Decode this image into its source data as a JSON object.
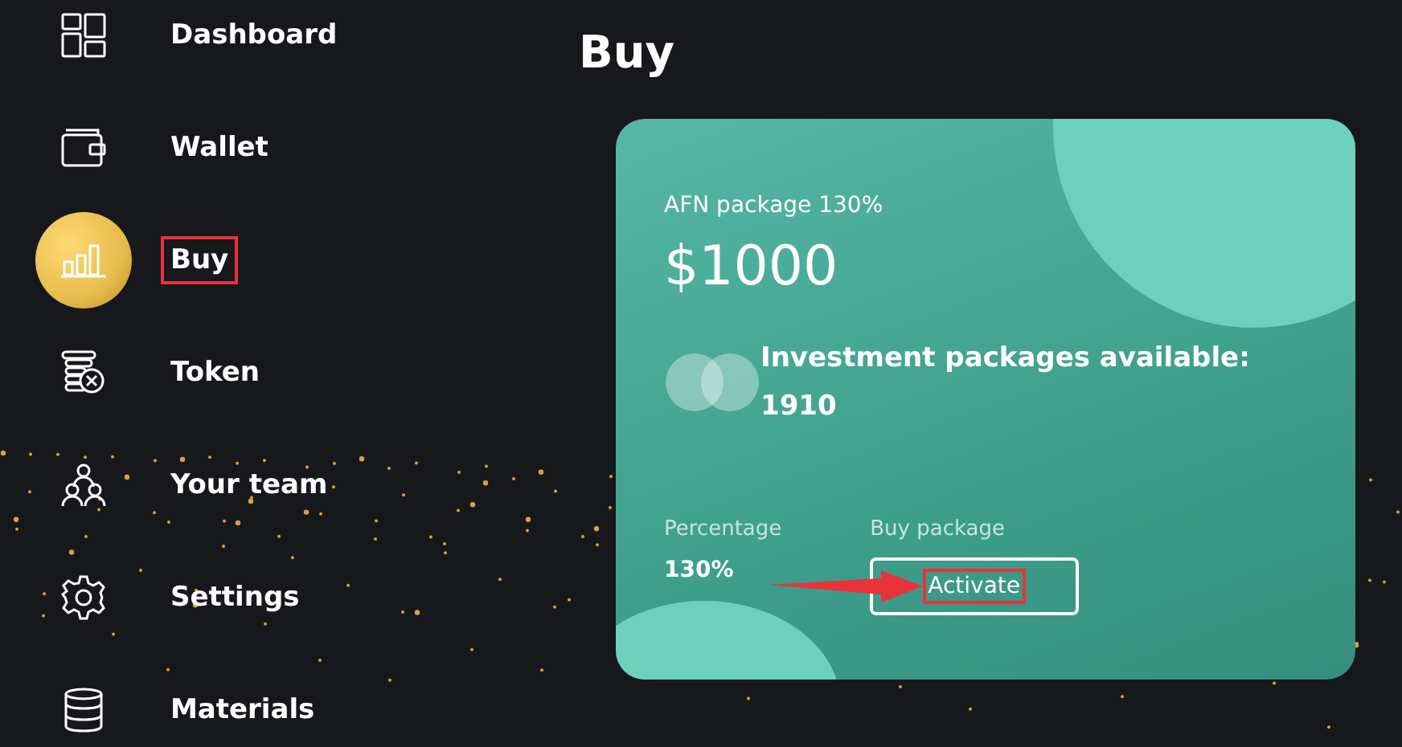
{
  "sidebar": {
    "items": [
      {
        "kind": "dashboard",
        "label": "Dashboard",
        "selected": false,
        "highlighted": false
      },
      {
        "kind": "wallet",
        "label": "Wallet",
        "selected": false,
        "highlighted": false
      },
      {
        "kind": "buy",
        "label": "Buy",
        "selected": true,
        "highlighted": true
      },
      {
        "kind": "token",
        "label": "Token",
        "selected": false,
        "highlighted": false
      },
      {
        "kind": "team",
        "label": "Your team",
        "selected": false,
        "highlighted": false
      },
      {
        "kind": "settings",
        "label": "Settings",
        "selected": false,
        "highlighted": false
      },
      {
        "kind": "materials",
        "label": "Materials",
        "selected": false,
        "highlighted": false
      }
    ]
  },
  "page": {
    "title": "Buy"
  },
  "card": {
    "name": "AFN package 130%",
    "price": "$1000",
    "availability": "Investment packages available: 1910",
    "percentage_label": "Percentage",
    "percentage": "130%",
    "buy_label": "Buy package",
    "button": {
      "label": "Activate",
      "highlighted": true
    }
  }
}
